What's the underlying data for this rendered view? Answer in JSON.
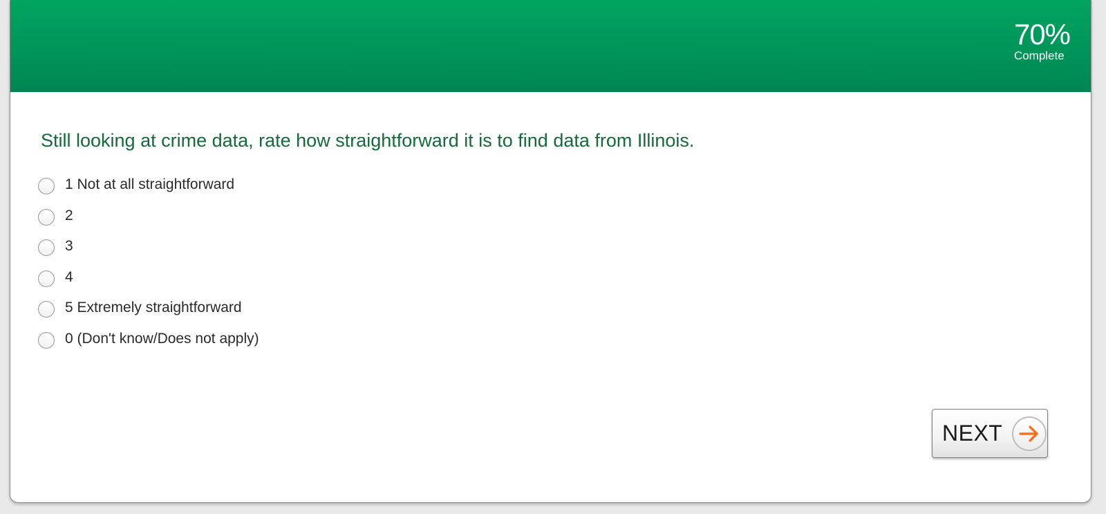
{
  "header": {
    "progress_percent": "70%",
    "progress_label": "Complete",
    "progress_value": 0.7,
    "color": "#00a45f"
  },
  "question": {
    "text": "Still looking at crime data, rate how straightforward it is to find data from Illinois.",
    "color": "#146b3a"
  },
  "options": [
    {
      "label": "1 Not at all straightforward",
      "selected": false
    },
    {
      "label": "2",
      "selected": false
    },
    {
      "label": "3",
      "selected": false
    },
    {
      "label": "4",
      "selected": false
    },
    {
      "label": "5 Extremely straightforward",
      "selected": false
    },
    {
      "label": "0 (Don't know/Does not apply)",
      "selected": false
    }
  ],
  "navigation": {
    "next_label": "NEXT",
    "next_icon": "arrow-right-icon",
    "accent": "#ff6a13"
  }
}
